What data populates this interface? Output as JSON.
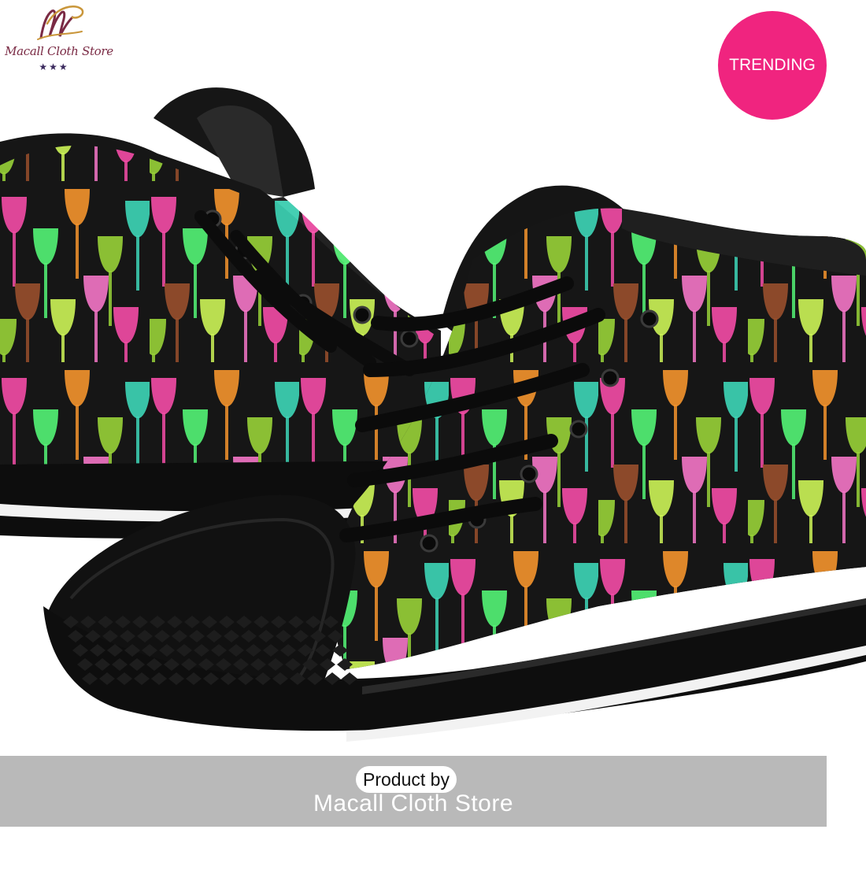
{
  "logo": {
    "name": "Macall Cloth Store",
    "monogram": "M",
    "stars": "★★★",
    "brand_color": "#7a2a44"
  },
  "badge": {
    "label": "TRENDING",
    "color": "#f0247f"
  },
  "banner": {
    "product_by": "Product by",
    "store": "Macall Cloth Store"
  },
  "photo": {
    "subject": "pair of black high-top canvas sneakers with colorful wine glass print",
    "shoe_color": "#141414",
    "glass_colors": [
      "#ff4fae",
      "#57ff7a",
      "#ff9a2e",
      "#9fdc3a",
      "#3fe0c0",
      "#a0522d",
      "#d6ff5a",
      "#ff7ad0"
    ]
  }
}
